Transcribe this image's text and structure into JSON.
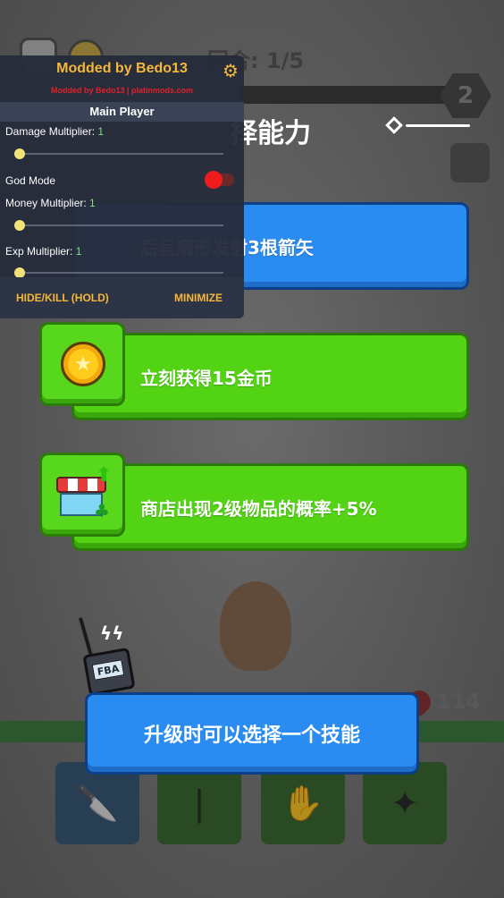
{
  "hud": {
    "round_text": "回合: 1/5",
    "level_badge": "2",
    "hp_value": "114"
  },
  "level_up": {
    "title_partial": "择能力",
    "options": [
      {
        "text": "后呈扇形发射3根箭矢",
        "color": "#2a8cf1",
        "icon": "bow-icon"
      },
      {
        "text": "立刻获得15金币",
        "color": "#52d414",
        "icon": "coin-icon"
      },
      {
        "text": "商店出现2级物品的概率+5%",
        "color": "#52d414",
        "icon": "shop-icon"
      }
    ],
    "tip": "升级时可以选择一个技能",
    "walkie_label": "FBA"
  },
  "mod_menu": {
    "title": "Modded by Bedo13",
    "subtitle": "Modded by Bedo13 | platinmods.com",
    "section": "Main Player",
    "damage": {
      "label": "Damage Multiplier:",
      "value": "1",
      "slider_fraction": 0
    },
    "god_mode": {
      "label": "God Mode",
      "enabled": false
    },
    "money": {
      "label": "Money Multiplier:",
      "value": "1",
      "slider_fraction": 0
    },
    "exp": {
      "label": "Exp Multiplier:",
      "value": "1",
      "slider_fraction": 0
    },
    "hide_button": "HIDE/KILL (HOLD)",
    "minimize_button": "MINIMIZE",
    "accent_color": "#f5b73a"
  },
  "inventory": {
    "slots": [
      {
        "icon": "knife-icon"
      },
      {
        "icon": "staff-icon"
      },
      {
        "icon": "glove-icon"
      },
      {
        "icon": "shuriken-icon"
      }
    ]
  }
}
